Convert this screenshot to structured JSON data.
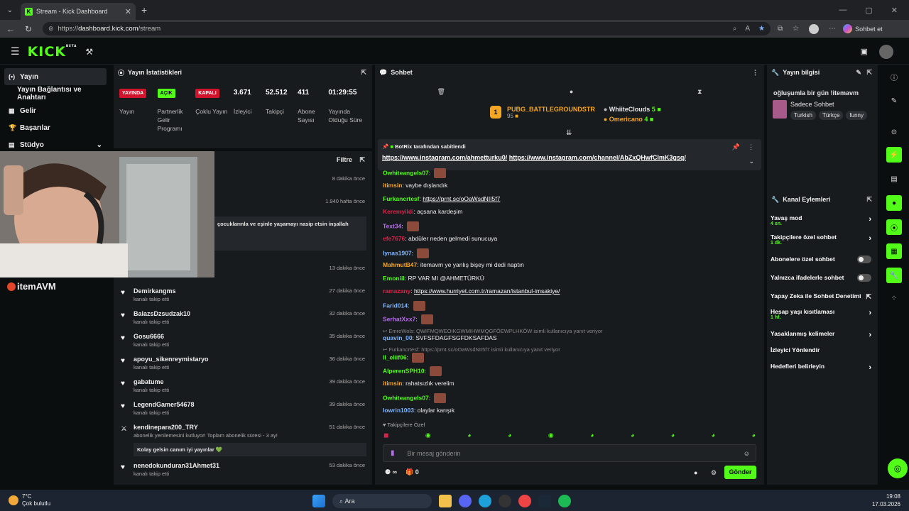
{
  "browser": {
    "tab_title": "Stream - Kick Dashboard",
    "url_prefix": "https://",
    "url_host": "dashboard.kick.com",
    "url_path": "/stream",
    "copilot_label": "Sohbet et"
  },
  "header": {
    "logo": "KICK",
    "beta": "BETA"
  },
  "sidebar": {
    "items": [
      {
        "label": "Yayın",
        "icon": "broadcast-icon"
      },
      {
        "label": "Yayın Bağlantısı ve Anahtarı",
        "icon": ""
      },
      {
        "label": "Gelir",
        "icon": "money-icon"
      },
      {
        "label": "Başarılar",
        "icon": "trophy-icon"
      },
      {
        "label": "Stüdyo",
        "icon": "studio-icon"
      }
    ],
    "brand_overlay": "itemAVM"
  },
  "stats": {
    "title": "Yayın İstatistikleri",
    "cells": [
      {
        "badge": "YAYINDA",
        "label": "Yayın"
      },
      {
        "badge": "AÇIK",
        "label": "Partnerlik Gelir Programı"
      },
      {
        "badge": "KAPALI",
        "label": "Çoklu Yayın"
      },
      {
        "value": "3.671",
        "label": "İzleyici"
      },
      {
        "value": "52.512",
        "label": "Takipçi"
      },
      {
        "value": "411",
        "label": "Abone Sayısı"
      },
      {
        "value": "01:29:55",
        "label": "Yayında Olduğu Süre"
      }
    ]
  },
  "feed": {
    "filter": "Filtre",
    "top_times": [
      "8 dakika önce",
      "1.940 hafta önce",
      "13 dakika önce"
    ],
    "snippet": "çocuklarınla ve eşinle yaşamayı nasip etsin inşallah",
    "events": [
      {
        "name": "Demirkangms",
        "sub": "kanalı takip etti",
        "time": "27 dakika önce"
      },
      {
        "name": "BalazsDzsudzak10",
        "sub": "kanalı takip etti",
        "time": "32 dakika önce"
      },
      {
        "name": "Gosu6666",
        "sub": "kanalı takip etti",
        "time": "35 dakika önce"
      },
      {
        "name": "apoyu_sikenreymistaryo",
        "sub": "kanalı takip etti",
        "time": "36 dakika önce"
      },
      {
        "name": "gabatume",
        "sub": "kanalı takip etti",
        "time": "39 dakika önce"
      },
      {
        "name": "LegendGamer54678",
        "sub": "kanalı takip etti",
        "time": "39 dakika önce"
      },
      {
        "name": "kendinepara200_TRY",
        "sub": "abonelik yenilemesini kutluyor! Toplam abonelik süresi - 3 ay!",
        "time": "51 dakika önce",
        "msg": "Kolay gelsin canım iyi yayınlar 💚"
      },
      {
        "name": "nenedokunduran31Ahmet31",
        "sub": "kanalı takip etti",
        "time": "53 dakika önce"
      }
    ]
  },
  "chat": {
    "title": "Sohbet",
    "leader1": {
      "name": "PUBG_BATTLEGROUNDSTR",
      "value": "95"
    },
    "leader2": {
      "name": "WhiiteClouds",
      "value": "5"
    },
    "leader3": {
      "name": "Omericano",
      "value": "4"
    },
    "pinned_by": "BotRix tarafından sabitlendi",
    "pinned_link1": "https://www.instagram.com/ahmetturku0/",
    "pinned_link2": "https://www.instagram.com/channel/AbZxQHwfCImK3gsq/",
    "messages": [
      {
        "user": "Owhiteangels07",
        "color": "#53fc18",
        "text": "",
        "emote": true
      },
      {
        "user": "itimsin",
        "color": "#f5a623",
        "text": "vaybe dışlandık"
      },
      {
        "user": "Furkancrtesf",
        "color": "#53fc18",
        "text": "",
        "link": "https://prnt.sc/oOaWsdNII5f7"
      },
      {
        "user": "Keremyildi",
        "color": "#d6244a",
        "text": "açsana kardeşim"
      },
      {
        "user": "Text34",
        "color": "#b86bf0",
        "text": "",
        "emote": true
      },
      {
        "user": "efe7676",
        "color": "#d6244a",
        "text": "abdüler neden gelmedi sunucuya"
      },
      {
        "user": "Iynas1907",
        "color": "#7fb5ff",
        "text": "",
        "emote": true
      },
      {
        "user": "MahmutB47",
        "color": "#f5a623",
        "text": "itemavm ye yanlış bişey mi dedi naptın"
      },
      {
        "user": "Emoniil",
        "color": "#53fc18",
        "text": "RP VAR MI @AHMETÜRKÜ"
      },
      {
        "user": "ramazany",
        "color": "#d6244a",
        "text": "",
        "link": "https://www.hurriyet.com.tr/ramazan/istanbul-imsakiye/"
      },
      {
        "user": "Farid014",
        "color": "#7fb5ff",
        "text": "",
        "emote": true
      },
      {
        "user": "SerhatXxx7",
        "color": "#b86bf0",
        "text": "",
        "emote": true
      }
    ],
    "reply1": "EmreWols: QWIFMQWEOIKGWMIHWMQGFÖEWPLHKÖW isimli kullanıcıya yanıt veriyor",
    "reply1_user": "quavin_00",
    "reply1_text": "SVFSFDAGFSGFDKSAFDAS",
    "reply2": "Furkancrtesf: https://prnt.sc/oOaWsdNII5f7 isimli kullanıcıya yanıt veriyor",
    "messages2": [
      {
        "user": "ll_eliif06",
        "color": "#53fc18",
        "text": "",
        "emote": true
      },
      {
        "user": "AlperenSPH10",
        "color": "#53fc18",
        "text": "",
        "emote": true
      },
      {
        "user": "itimsin",
        "color": "#f5a623",
        "text": "rahatsızlık verelim"
      },
      {
        "user": "Owhiteangels07",
        "color": "#53fc18",
        "text": "",
        "emote": true
      },
      {
        "user": "Iowrin1003",
        "color": "#7fb5ff",
        "text": "olaylar karışık"
      }
    ],
    "followers_only": "Takipçilere Özel",
    "input_placeholder": "Bir mesaj gönderin",
    "send": "Gönder",
    "counter": "0"
  },
  "stream_info": {
    "title": "Yayın bilgisi",
    "stream_title": "oğluşumla bir gün !itemavm",
    "category": "Sadece Sohbet",
    "tags": [
      "Turkish",
      "Türkçe",
      "funny"
    ]
  },
  "channel_actions": {
    "title": "Kanal Eylemleri",
    "items": [
      {
        "label": "Yavaş mod",
        "sub": "4 sn.",
        "kind": "chev"
      },
      {
        "label": "Takipçilere özel sohbet",
        "sub": "1 dk.",
        "kind": "chev"
      },
      {
        "label": "Abonelere özel sohbet",
        "kind": "toggle"
      },
      {
        "label": "Yalnızca ifadelerle sohbet",
        "kind": "toggle"
      },
      {
        "label": "Yapay Zeka ile Sohbet Denetimi",
        "kind": "ext"
      },
      {
        "label": "Hesap yaşı kısıtlaması",
        "sub": "1 hf.",
        "kind": "chev"
      },
      {
        "label": "Yasaklanmış kelimeler",
        "kind": "chev"
      },
      {
        "label": "İzleyici Yönlendir",
        "kind": "none"
      },
      {
        "label": "Hedefleri belirleyin",
        "kind": "chev"
      }
    ]
  },
  "taskbar": {
    "temp": "7°C",
    "weather": "Çok bulutlu",
    "search": "Ara",
    "time": "19:08",
    "date": "17.03.2026"
  },
  "colors": {
    "accent": "#53fc18",
    "live": "#d1142c",
    "panel": "#181b1e"
  }
}
